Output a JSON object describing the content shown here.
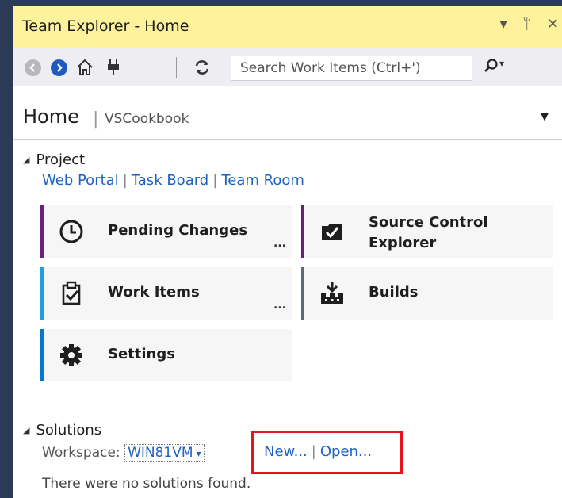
{
  "window": {
    "title": "Team Explorer - Home",
    "controls": [
      "▾",
      "ᛘ",
      "✕"
    ]
  },
  "toolbar": {
    "icons": [
      "back-icon",
      "forward-icon",
      "home-icon",
      "connect-icon",
      "refresh-icon"
    ],
    "search_placeholder": "Search Work Items (Ctrl+')"
  },
  "header": {
    "title": "Home",
    "separator": "|",
    "subtitle": "VSCookbook"
  },
  "project": {
    "heading": "Project",
    "links": [
      "Web Portal",
      "Task Board",
      "Team Room"
    ],
    "tiles": [
      {
        "label": "Pending Changes",
        "icon": "clock-icon",
        "accent": "#68217a",
        "more": "..."
      },
      {
        "label": "Source Control Explorer",
        "icon": "source-control-icon",
        "accent": "#68217a"
      },
      {
        "label": "Work Items",
        "icon": "work-items-icon",
        "accent": "#1ba1e2",
        "more": "..."
      },
      {
        "label": "Builds",
        "icon": "builds-icon",
        "accent": "#5c6b7a"
      },
      {
        "label": "Settings",
        "icon": "gear-icon",
        "accent": "#007acc"
      }
    ]
  },
  "solutions": {
    "heading": "Solutions",
    "workspace_label": "Workspace:",
    "workspace_value": "WIN81VM",
    "links": [
      "New...",
      "Open..."
    ],
    "empty_message": "There were no solutions found."
  },
  "colors": {
    "title_bar": "#fff29d",
    "link": "#1e62c3",
    "highlight": "#e8131b"
  }
}
